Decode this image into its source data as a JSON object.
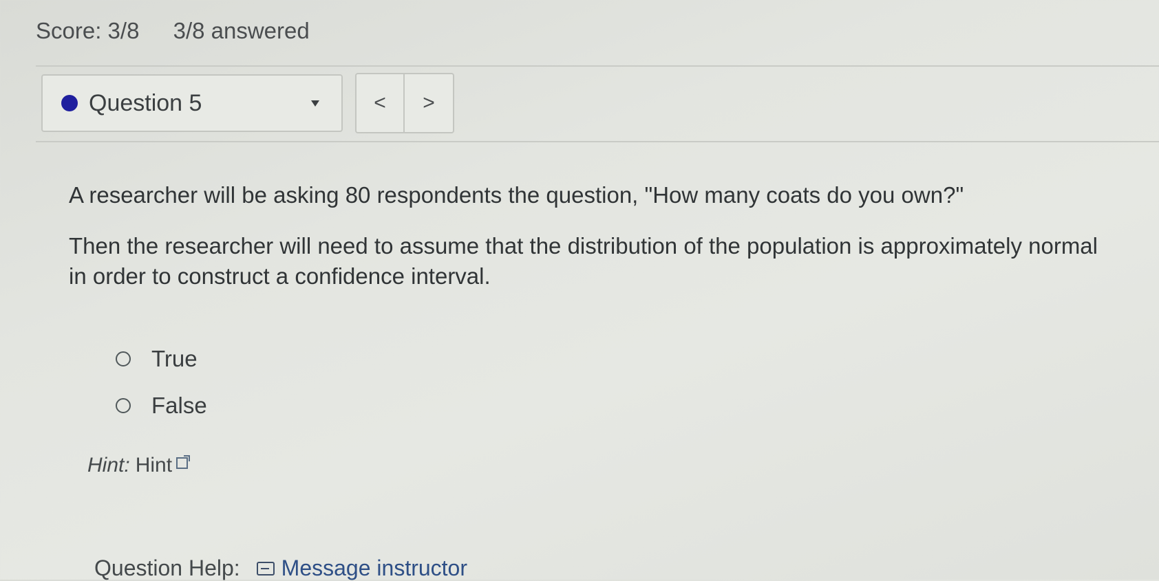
{
  "header": {
    "score": "Score: 3/8",
    "answered": "3/8 answered"
  },
  "question_nav": {
    "selected_question": "Question 5",
    "prev_symbol": "<",
    "next_symbol": ">",
    "status_color": "#1f1f9e"
  },
  "question": {
    "paragraphs": [
      "A researcher will be asking 80 respondents the question, \"How many coats do you own?\"",
      "Then the researcher will need to assume that the distribution of the population is approximately normal in order to construct a confidence interval."
    ]
  },
  "answers": [
    {
      "label": "True",
      "selected": false
    },
    {
      "label": "False",
      "selected": false
    }
  ],
  "hint": {
    "prefix": "Hint:",
    "link": "Hint"
  },
  "help": {
    "label": "Question Help:",
    "message_link": "Message instructor"
  }
}
